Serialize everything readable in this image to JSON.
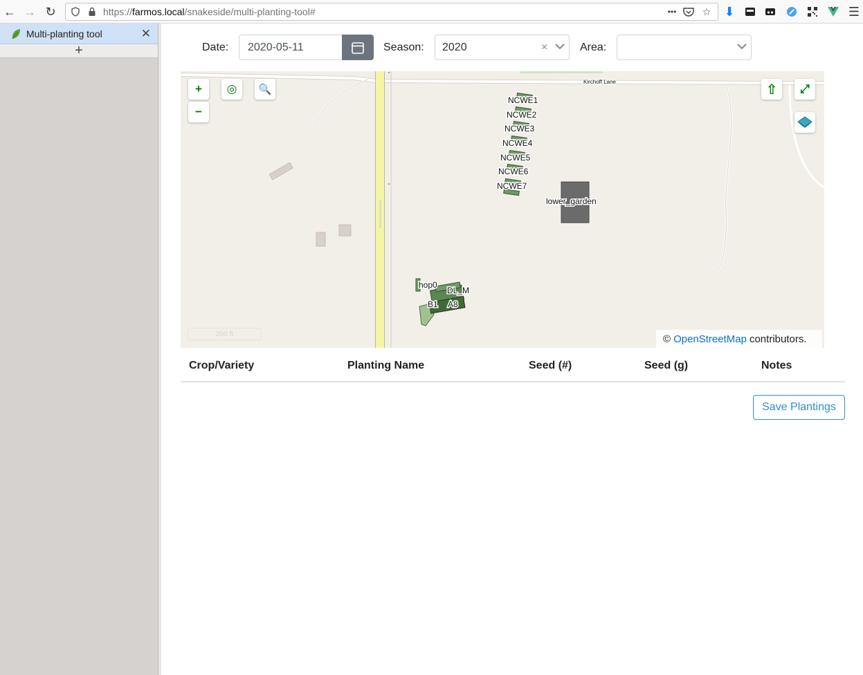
{
  "browser": {
    "url_prefix": "https://",
    "url_host": "farmos.local",
    "url_path": "/snakeside/multi-planting-tool#",
    "page_actions_icon": "•••"
  },
  "sidebar": {
    "tab_label": "Multi-planting tool",
    "close_glyph": "✕",
    "new_tab_glyph": "+"
  },
  "filters": {
    "date_label": "Date:",
    "date_value": "2020-05-11",
    "season_label": "Season:",
    "season_value": "2020",
    "season_clear": "×",
    "area_label": "Area:",
    "area_value": ""
  },
  "map": {
    "zoom_in": "+",
    "zoom_out": "−",
    "geolocate": "◎",
    "search": "🔍",
    "north": "⇧",
    "fullscreen": "⤢",
    "road_label": "Kirchoff Lane",
    "scale_label": "200 ft",
    "areas": [
      "NCWE1",
      "NCWE2",
      "NCWE3",
      "NCWE4",
      "NCWE5",
      "NCWE6",
      "NCWE7",
      "lower_garden",
      "hop0",
      "DL_M",
      "B1",
      "A8"
    ],
    "attribution_prefix": "©",
    "attribution_link": "OpenStreetMap",
    "attribution_suffix": "contributors."
  },
  "table": {
    "columns": [
      "Crop/Variety",
      "Planting Name",
      "Seed (#)",
      "Seed (g)",
      "Notes"
    ]
  },
  "save_button": "Save Plantings",
  "colors": {
    "accent": "#2d8ed0",
    "calendar_button": "#6c757d",
    "map_green": "#0a7a0a",
    "sidebar_tab": "#cfe1f7"
  }
}
